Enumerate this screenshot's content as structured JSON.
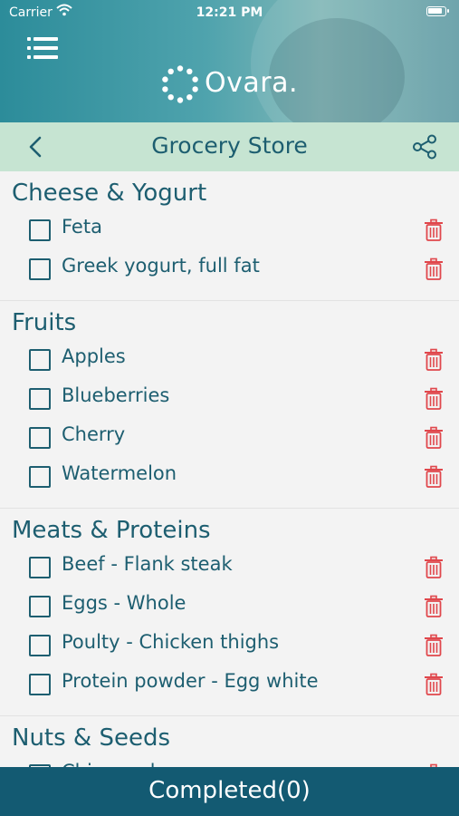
{
  "status_bar": {
    "carrier": "Carrier",
    "time": "12:21 PM"
  },
  "brand": {
    "name": "Ovara."
  },
  "nav": {
    "title": "Grocery Store"
  },
  "colors": {
    "accent": "#1d5e70",
    "nav_bg": "#c6e4d2",
    "delete": "#e0474c",
    "footer_bg": "#135a72"
  },
  "sections": [
    {
      "title": "Cheese & Yogurt",
      "items": [
        {
          "label": "Feta"
        },
        {
          "label": "Greek yogurt, full fat"
        }
      ]
    },
    {
      "title": "Fruits",
      "items": [
        {
          "label": "Apples"
        },
        {
          "label": "Blueberries"
        },
        {
          "label": "Cherry"
        },
        {
          "label": "Watermelon"
        }
      ]
    },
    {
      "title": "Meats & Proteins",
      "items": [
        {
          "label": "Beef - Flank steak"
        },
        {
          "label": "Eggs - Whole"
        },
        {
          "label": "Poulty - Chicken thighs"
        },
        {
          "label": "Protein powder - Egg white"
        }
      ]
    },
    {
      "title": "Nuts & Seeds",
      "items": [
        {
          "label": "Chia seeds"
        }
      ]
    }
  ],
  "footer": {
    "label": "Completed(0)"
  }
}
